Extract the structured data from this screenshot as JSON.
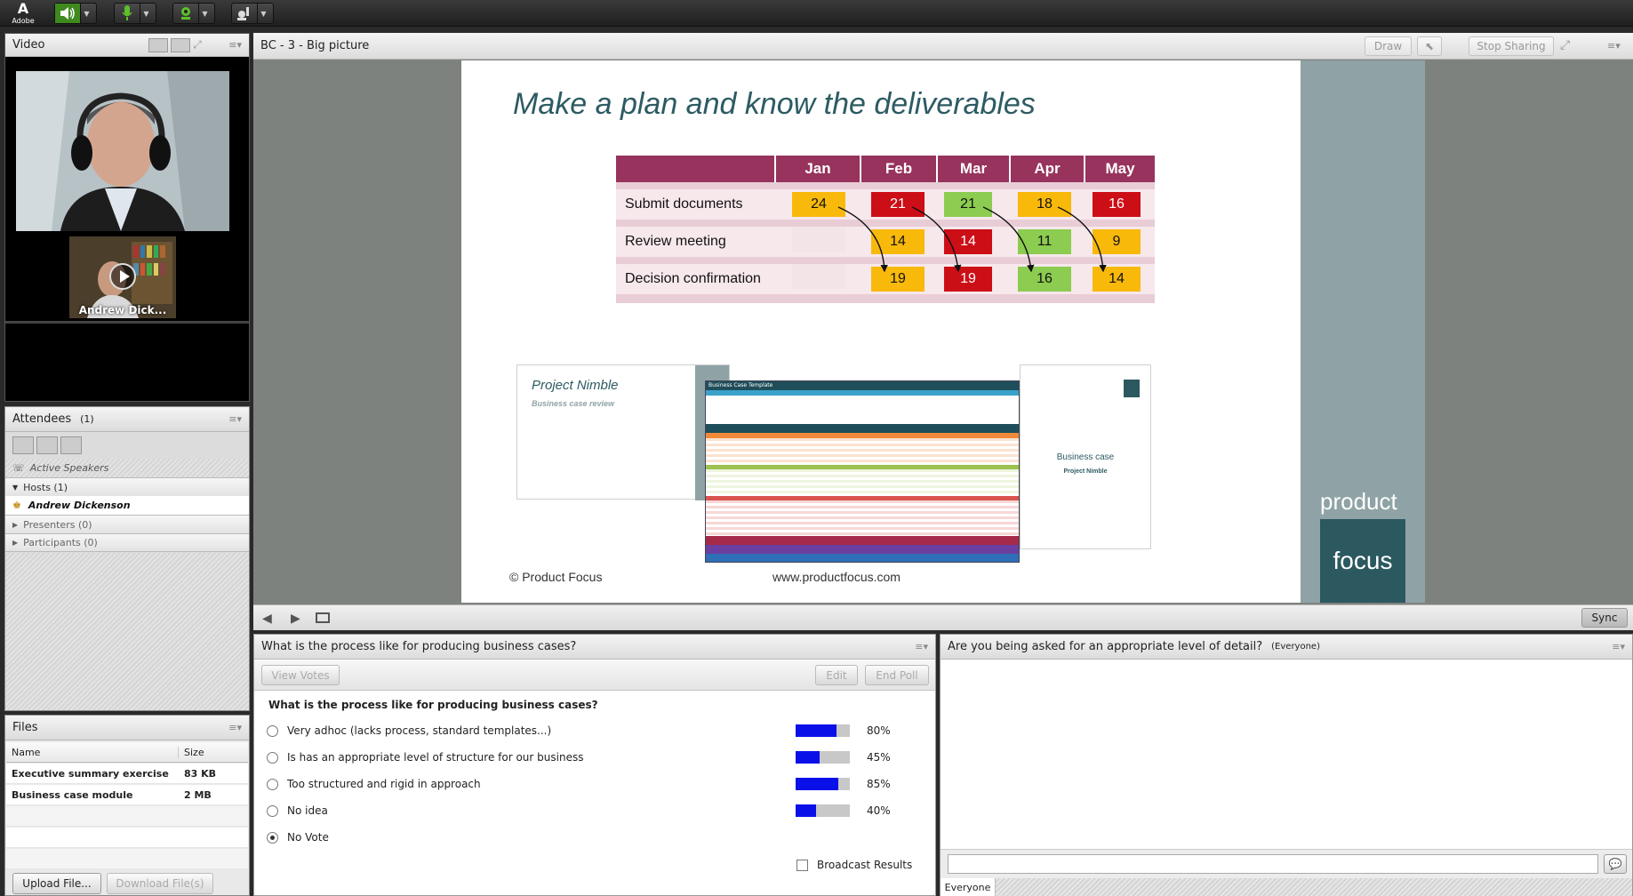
{
  "topbar": {
    "logo_letter": "A",
    "logo_text": "Adobe"
  },
  "video": {
    "title": "Video",
    "thumb_name": "Andrew Dick..."
  },
  "attendees": {
    "title": "Attendees",
    "count": "(1)",
    "active_speakers": "Active Speakers",
    "hosts": "Hosts (1)",
    "host_name": "Andrew Dickenson",
    "presenters": "Presenters (0)",
    "participants": "Participants (0)"
  },
  "files": {
    "title": "Files",
    "col_name": "Name",
    "col_size": "Size",
    "rows": [
      {
        "name": "Executive summary exercise",
        "size": "83 KB"
      },
      {
        "name": "Business case module",
        "size": "2 MB"
      }
    ],
    "upload": "Upload File...",
    "download": "Download File(s)"
  },
  "share": {
    "title": "BC - 3 - Big picture",
    "draw": "Draw",
    "stop": "Stop Sharing",
    "sync": "Sync",
    "slide": {
      "title": "Make a plan and know the deliverables",
      "months": [
        "Jan",
        "Feb",
        "Mar",
        "Apr",
        "May"
      ],
      "rows": [
        {
          "label": "Submit documents",
          "values": [
            "24",
            "21",
            "21",
            "18",
            "16"
          ]
        },
        {
          "label": "Review meeting",
          "values": [
            "",
            "14",
            "14",
            "11",
            "9"
          ]
        },
        {
          "label": "Decision confirmation",
          "values": [
            "",
            "19",
            "19",
            "16",
            "14"
          ]
        }
      ],
      "nimble_title": "Project Nimble",
      "nimble_sub": "Business case review",
      "bc_title": "Business case",
      "bc_sub": "Project Nimble",
      "sheet_title": "Business Case Template",
      "copyright": "© Product Focus",
      "url": "www.productfocus.com",
      "brand_product": "product",
      "brand_focus": "focus"
    }
  },
  "poll": {
    "header": "What is the process like for producing business cases?",
    "view_votes": "View Votes",
    "edit": "Edit",
    "end_poll": "End Poll",
    "question": "What is the process like for producing business cases?",
    "options": [
      {
        "label": "Very adhoc (lacks process, standard templates...)",
        "percent": "80%",
        "fill": 0.75
      },
      {
        "label": "Is has an appropriate level of structure for our business",
        "percent": "45%",
        "fill": 0.45
      },
      {
        "label": "Too structured and rigid in approach",
        "percent": "85%",
        "fill": 0.78
      },
      {
        "label": "No idea",
        "percent": "40%",
        "fill": 0.38
      },
      {
        "label": "No Vote",
        "percent": "",
        "fill": 0
      }
    ],
    "broadcast": "Broadcast Results"
  },
  "chat": {
    "header": "Are you being asked for an appropriate level of detail?",
    "audience": "(Everyone)",
    "tab": "Everyone",
    "input_value": ""
  }
}
